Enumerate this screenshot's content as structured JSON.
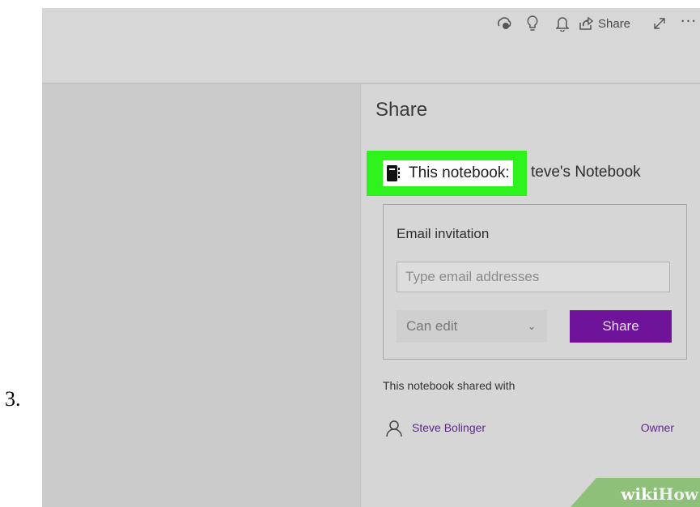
{
  "step": {
    "number": "3."
  },
  "toolbar": {
    "share_label": "Share",
    "more_label": "···",
    "icons": [
      "catch-up-icon",
      "lightbulb-icon",
      "bell-icon",
      "share-icon",
      "expand-icon",
      "more-icon"
    ]
  },
  "panel": {
    "title": "Share",
    "notebook_label": "This notebook:",
    "notebook_name": "teve's Notebook",
    "highlight_color": "#2ef21c"
  },
  "invite": {
    "title": "Email invitation",
    "email_placeholder": "Type email addresses",
    "permission_selected": "Can edit",
    "share_button": "Share",
    "share_button_color": "#6e139a"
  },
  "shared_with": {
    "label": "This notebook shared with",
    "users": [
      {
        "name": "Steve Bolinger",
        "role": "Owner"
      }
    ]
  },
  "watermark": {
    "part1": "wiki",
    "part2": "How"
  }
}
